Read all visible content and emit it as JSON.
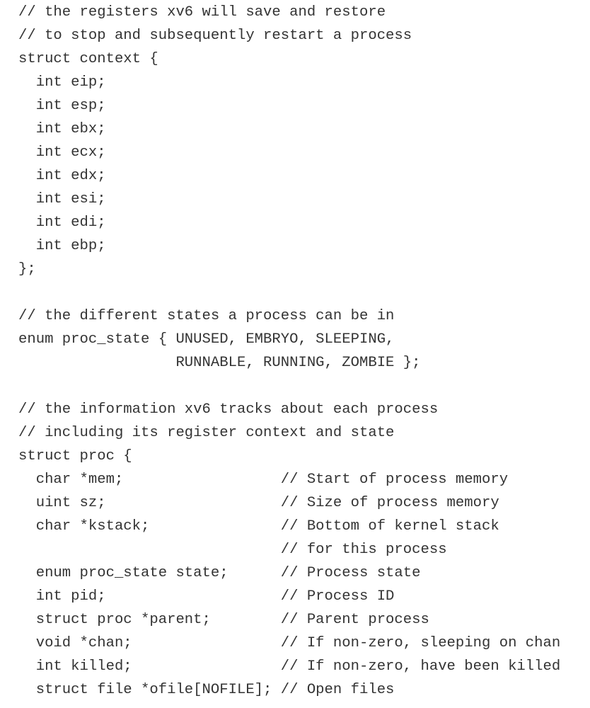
{
  "code": {
    "lines": [
      "// the registers xv6 will save and restore",
      "// to stop and subsequently restart a process",
      "struct context {",
      "  int eip;",
      "  int esp;",
      "  int ebx;",
      "  int ecx;",
      "  int edx;",
      "  int esi;",
      "  int edi;",
      "  int ebp;",
      "};",
      "",
      "// the different states a process can be in",
      "enum proc_state { UNUSED, EMBRYO, SLEEPING,",
      "                  RUNNABLE, RUNNING, ZOMBIE };",
      "",
      "// the information xv6 tracks about each process",
      "// including its register context and state",
      "struct proc {",
      "  char *mem;                  // Start of process memory",
      "  uint sz;                    // Size of process memory",
      "  char *kstack;               // Bottom of kernel stack",
      "                              // for this process",
      "  enum proc_state state;      // Process state",
      "  int pid;                    // Process ID",
      "  struct proc *parent;        // Parent process",
      "  void *chan;                 // If non-zero, sleeping on chan",
      "  int killed;                 // If non-zero, have been killed",
      "  struct file *ofile[NOFILE]; // Open files"
    ]
  }
}
